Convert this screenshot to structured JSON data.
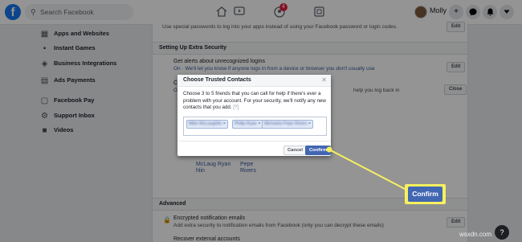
{
  "header": {
    "logo": "f",
    "search_placeholder": "Search Facebook",
    "notification_badge": "4",
    "profile_name": "Molly",
    "icons": [
      "home-icon",
      "watch-icon",
      "groups-icon",
      "gaming-icon",
      "plus-icon",
      "messenger-icon",
      "bell-icon",
      "caret-down-icon"
    ]
  },
  "sidebar": {
    "items": [
      {
        "label": "Apps and Websites",
        "icon": "apps-icon"
      },
      {
        "label": "Instant Games",
        "icon": "games-icon"
      },
      {
        "label": "Business Integrations",
        "icon": "integrations-icon"
      },
      {
        "label": "Ads Payments",
        "icon": "payments-icon"
      },
      {
        "label": "Facebook Pay",
        "icon": "pay-icon"
      },
      {
        "label": "Support Inbox",
        "icon": "inbox-icon"
      },
      {
        "label": "Videos",
        "icon": "videos-icon"
      }
    ]
  },
  "panel": {
    "top_line": "Use special passwords to log into your apps instead of using your Facebook password or login codes.",
    "edit1": "Edit",
    "section_extra": "Setting Up Extra Security",
    "alerts_title": "Get alerts about unrecognized logins",
    "alerts_sub": "On · We'll let you know if anyone logs in from a device or browser you don't usually use",
    "edit2": "Edit",
    "ch_title": "Ch",
    "ch_sub": "On",
    "ch_right": "help you log back in",
    "close": "Close",
    "contacts": [
      "McLaug",
      "hlin",
      "Ryan",
      "Pepe",
      "Rivers"
    ],
    "section_advanced": "Advanced",
    "enc_title": "Encrypted notification emails",
    "enc_sub": "Add extra security to notification emails from Facebook (only you can decrypt these emails)",
    "edit3": "Edit",
    "recover": "Recover external accounts"
  },
  "modal": {
    "title": "Choose Trusted Contacts",
    "description": "Choose 3 to 5 friends that you can call for help if there's ever a problem with your account. For your security, we'll notify any new contacts that you add.",
    "help_mark": "[?]",
    "tokens": [
      "Mike McLaughlin",
      "Philip Ryan",
      "Michaela Pepe Rivers"
    ],
    "cancel_label": "Cancel",
    "confirm_label": "Confirm"
  },
  "callout": {
    "label": "Confirm",
    "highlight_color": "#f7f05e",
    "button_color": "#4267b2"
  },
  "watermark": "wsxdn.com"
}
